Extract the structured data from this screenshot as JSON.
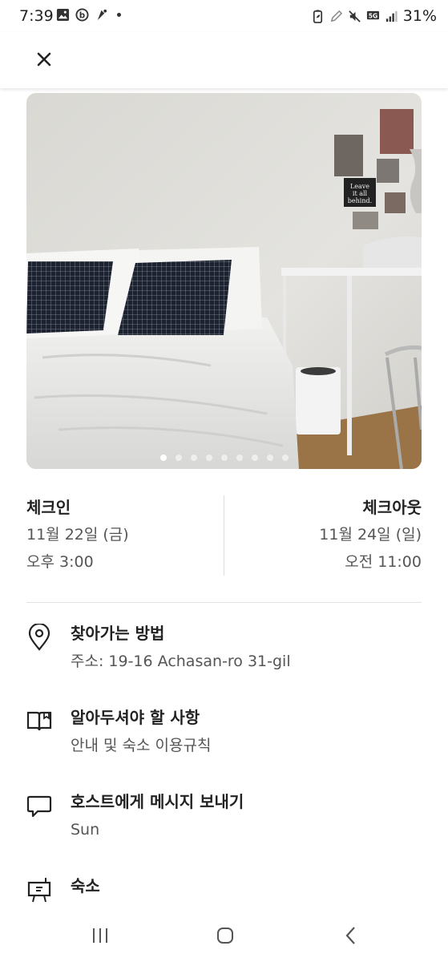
{
  "status_bar": {
    "time": "7:39",
    "network": "5G",
    "battery": "31%",
    "left_icons": [
      "gallery-icon",
      "b-app-icon",
      "bixby-icon"
    ],
    "right_icons": [
      "battery-saver-icon",
      "pen-icon",
      "mute-icon",
      "5g-icon",
      "signal-icon"
    ]
  },
  "header": {
    "close_icon": "close-icon"
  },
  "photo": {
    "poster_text": "Leave it all behind.",
    "page_count": 9,
    "active_index": 0
  },
  "check_in": {
    "title": "체크인",
    "date": "11월 22일 (금)",
    "time": "오후 3:00"
  },
  "check_out": {
    "title": "체크아웃",
    "date": "11월 24일 (일)",
    "time": "오전 11:00"
  },
  "items": [
    {
      "icon": "location-pin-icon",
      "title": "찾아가는 방법",
      "subtitle": "주소: 19-16 Achasan-ro 31-gil"
    },
    {
      "icon": "book-icon",
      "title": "알아두셔야 할 사항",
      "subtitle": "안내 및 숙소 이용규칙"
    },
    {
      "icon": "chat-icon",
      "title": "호스트에게 메시지 보내기",
      "subtitle": "Sun"
    },
    {
      "icon": "listing-icon",
      "title": "숙소",
      "subtitle": ""
    }
  ],
  "nav": {
    "icons": [
      "recent-apps-icon",
      "home-icon",
      "back-icon"
    ]
  },
  "colors": {
    "text": "#222222",
    "secondary": "#555555",
    "divider": "#dddddd"
  }
}
